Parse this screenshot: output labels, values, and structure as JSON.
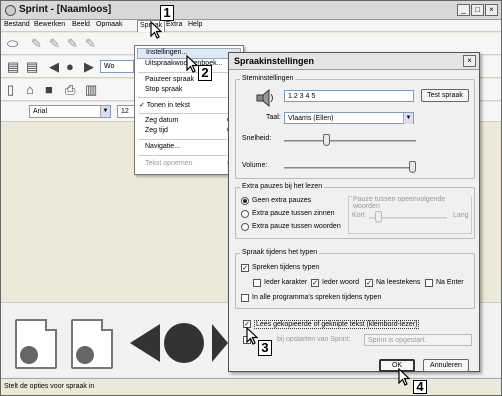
{
  "window": {
    "title": "Sprint - [Naamloos]",
    "controls": [
      "_",
      "□",
      "×"
    ]
  },
  "menubar": {
    "items": [
      "Bestand",
      "Bewerken",
      "Beeld",
      "Opmaak",
      "Spraak",
      "Extra",
      "Help"
    ]
  },
  "toolbar": {
    "voice_combo": "Wo",
    "font_combo": "Arial",
    "size_combo": "12"
  },
  "spraak_menu": {
    "items": [
      {
        "label": "Instellingen...",
        "shortcut": ""
      },
      {
        "label": "Uitspraakwoordenboek...",
        "shortcut": ""
      },
      {
        "label": "Pauzeer spraak",
        "shortcut": ""
      },
      {
        "label": "Stop spraak",
        "shortcut": ""
      },
      {
        "label": "Tonen in tekst",
        "shortcut": ""
      },
      {
        "label": "Zeg datum",
        "shortcut": "C"
      },
      {
        "label": "Zeg tijd",
        "shortcut": "C"
      },
      {
        "label": "Navigatie...",
        "shortcut": ""
      },
      {
        "label": "Tekst opnemen",
        "shortcut": "C"
      }
    ],
    "checkmark": "✓"
  },
  "dialog": {
    "title": "Spraakinstellingen",
    "close": "×",
    "voice_group": {
      "title": "Steminstellingen",
      "test_text": "1 2 3 4 5",
      "test_button": "Test spraak",
      "language_label": "Taal:",
      "language_value": "Vlaams (Ellen)",
      "speed_label": "Snelheid:",
      "speed_level": 0.32,
      "volume_label": "Volume:",
      "volume_level": 0.97
    },
    "pause_group": {
      "title": "Extra pauzes bij het lezen",
      "options": [
        "Geen extra pauzes",
        "Extra pauze tussen zinnen",
        "Extra pauze tussen woorden"
      ],
      "selected": 0,
      "between_label": "Pauze tussen opeenvolgende woorden",
      "short_label": "Kort",
      "long_label": "Lang",
      "pause_level": 0.12
    },
    "typing_group": {
      "title": "Spraak tijdens het typen",
      "speak_while_typing": "Spreken tijdens typen",
      "opt_letter": "Ieder karakter",
      "opt_word": "Ieder woord",
      "opt_punct": "Na leestekens",
      "opt_enter": "Na Enter",
      "all_programs": "In alle programma's spreken tijdens typen"
    },
    "clipboard_label": "Lees gekopieerde of geknipte tekst (klembord-lezer)",
    "startup_label": "bij opstarten van Sprint:",
    "startup_value": "Sprint is opgestart.",
    "ok": "OK",
    "cancel": "Annuleren"
  },
  "markers": [
    "1",
    "2",
    "3",
    "4"
  ],
  "status": "Stelt de opties voor spraak in",
  "icons": [
    "app-icon",
    "eraser-icon",
    "pencil-icon",
    "prev-icon",
    "play-icon",
    "next-icon",
    "new-doc-icon",
    "open-icon",
    "save-icon",
    "print-icon",
    "speaker-doc-icon"
  ]
}
